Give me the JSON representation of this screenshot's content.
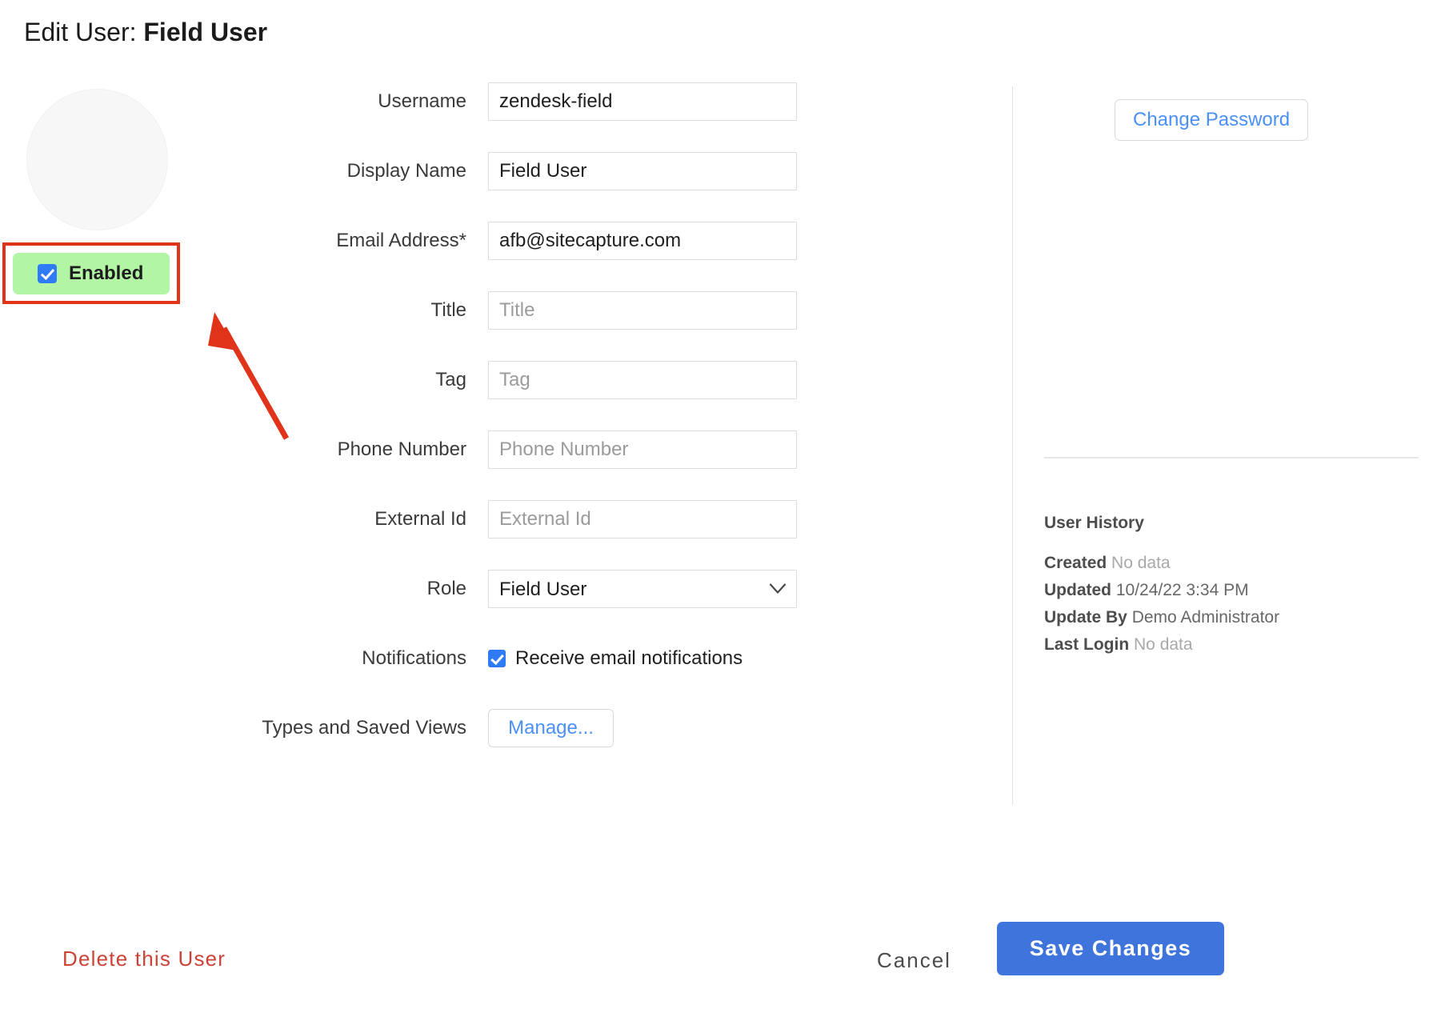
{
  "header": {
    "title_prefix": "Edit User:",
    "title_name": "Field User"
  },
  "left": {
    "avatar_alt": "user-avatar",
    "enabled_label": "Enabled",
    "enabled_checked": true,
    "highlight_color": "#b2f5a5",
    "annotation_color": "#e0331a"
  },
  "form": {
    "fields": [
      {
        "label": "Username",
        "value": "zendesk-field",
        "placeholder": "Username"
      },
      {
        "label": "Display Name",
        "value": "Field User",
        "placeholder": "Display Name"
      },
      {
        "label": "Email Address*",
        "value": "afb@sitecapture.com",
        "placeholder": "Email Address"
      },
      {
        "label": "Title",
        "value": "",
        "placeholder": "Title"
      },
      {
        "label": "Tag",
        "value": "",
        "placeholder": "Tag"
      },
      {
        "label": "Phone Number",
        "value": "",
        "placeholder": "Phone Number"
      },
      {
        "label": "External Id",
        "value": "",
        "placeholder": "External Id"
      }
    ],
    "role": {
      "label": "Role",
      "selected": "Field User",
      "options": [
        "Field User"
      ],
      "chevron_icon": "chevron-down-icon"
    },
    "notifications": {
      "label": "Notifications",
      "checkbox_label": "Receive email notifications",
      "checked": true
    },
    "types_views": {
      "label": "Types and Saved Views",
      "button_label": "Manage..."
    }
  },
  "right": {
    "change_password_label": "Change Password",
    "history_title": "User History",
    "history": [
      {
        "key": "Created",
        "value": "No data",
        "muted": true
      },
      {
        "key": "Updated",
        "value": "10/24/22 3:34 PM",
        "muted": false
      },
      {
        "key": "Update By",
        "value": "Demo Administrator",
        "muted": false
      },
      {
        "key": "Last Login",
        "value": "No data",
        "muted": true
      }
    ]
  },
  "footer": {
    "delete_label": "Delete this User",
    "cancel_label": "Cancel",
    "save_label": "Save Changes",
    "save_color": "#3f74dd",
    "delete_color": "#cc4236"
  }
}
